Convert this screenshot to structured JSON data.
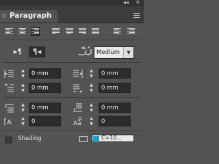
{
  "window": {
    "collapse_glyph": "◂◂",
    "close_glyph": "✕"
  },
  "panel": {
    "title": "Paragraph",
    "tab_arrow": "◇",
    "menu_icon": "panel-menu-icon"
  },
  "alignment": {
    "buttons": [
      "align-left",
      "align-center",
      "align-right",
      "justify-left",
      "justify-center",
      "justify-right",
      "justify-all",
      "align-towards-spine",
      "align-away-from-spine"
    ],
    "active": "align-right"
  },
  "direction": {
    "ltr_glyph": "▸¶",
    "rtl_glyph": "¶◂",
    "active": "right-to-left"
  },
  "language_style": {
    "value": "Medium",
    "icon": "arabic-calligraphy-icon"
  },
  "fields": {
    "left_indent": "0 mm",
    "right_indent": "0 mm",
    "first_line_indent": "0 mm",
    "last_line_indent": "0 mm",
    "space_before": "0 mm",
    "space_after": "0 mm",
    "drop_cap_lines": "0",
    "drop_cap_chars": "0"
  },
  "shading": {
    "label": "Shading",
    "checked": false,
    "color_text": "C=10..."
  },
  "colors": {
    "panel_bg": "#535353",
    "header_bg": "#3c3c3c",
    "field_bg": "#2c2c2c",
    "swatch": "#14a3c8"
  }
}
